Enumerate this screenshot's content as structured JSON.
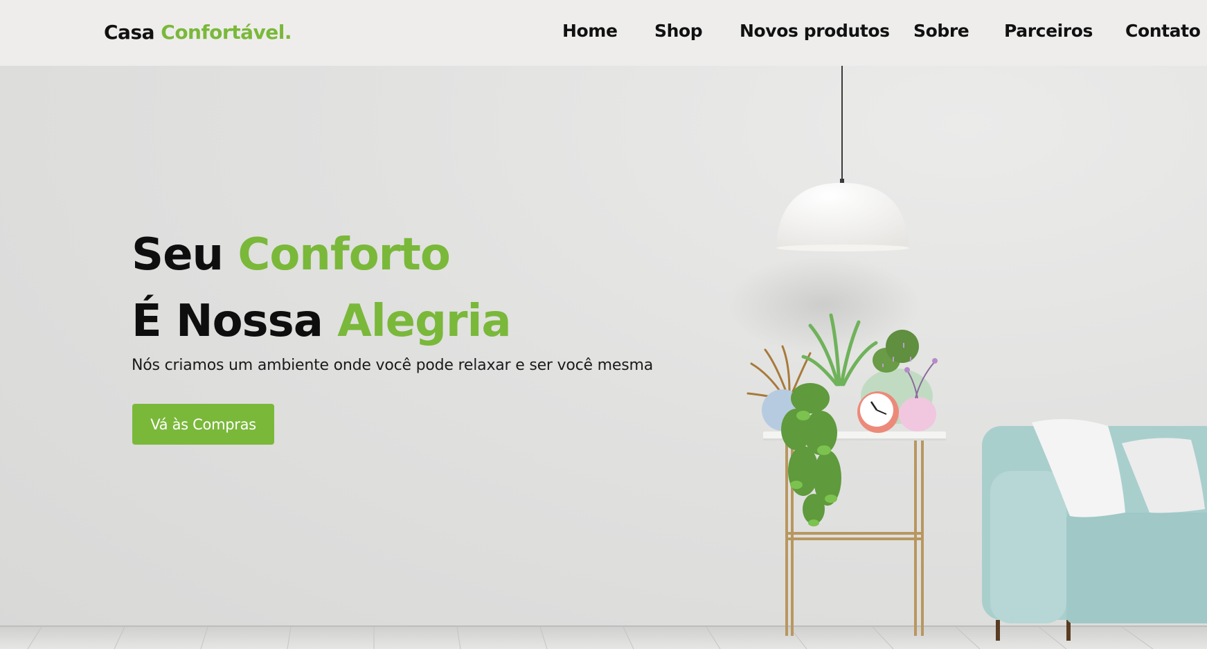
{
  "brand": {
    "prefix": "Casa",
    "highlight": "Confortável."
  },
  "nav": [
    {
      "label": "Home"
    },
    {
      "label": "Shop"
    },
    {
      "label": "Novos produtos"
    },
    {
      "label": "Sobre"
    },
    {
      "label": "Parceiros"
    },
    {
      "label": "Contato"
    }
  ],
  "hero": {
    "line1": {
      "black": "Seu",
      "green": "Conforto"
    },
    "line2": {
      "black": "É Nossa",
      "green": "Alegria"
    },
    "subtitle": "Nós criamos um ambiente onde você pode relaxar e ser você mesma",
    "cta_label": "Vá às Compras"
  },
  "colors": {
    "accent": "#7ab83a",
    "nav_background": "#eeedec",
    "wall": "#dcdcdb",
    "text": "#111111",
    "sofa": "#a9cfcd"
  }
}
